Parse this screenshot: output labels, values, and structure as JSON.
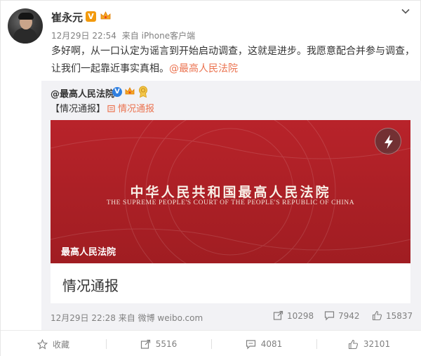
{
  "post": {
    "username": "崔永元",
    "time": "12月29日 22:54",
    "source_prefix": "来自",
    "source": "iPhone客户端",
    "text_main": "多好啊，从一口认定为谣言到开始启动调查，这就是进步。我愿意配合并参与调查，让我们一起靠近事实真相。",
    "mention": "@最高人民法院"
  },
  "repost": {
    "username": "@最高人民法院",
    "tag": "【情况通报】",
    "link_label": "情况通报",
    "card": {
      "banner_title_cn": "中华人民共和国最高人民法院",
      "banner_title_en": "THE SUPREME PEOPLE'S COURT OF THE PEOPLE'S REPUBLIC OF CHINA",
      "banner_source": "最高人民法院",
      "title": "情况通报"
    },
    "time": "12月29日 22:28",
    "source_prefix": "来自",
    "source": "微博 weibo.com",
    "reposts": "10298",
    "comments": "7942",
    "likes": "15837"
  },
  "actions": {
    "favorite": "收藏",
    "repost": "5516",
    "comment": "4081",
    "like": "32101"
  },
  "icons": [
    "chevron-down-icon",
    "verified-v-icon",
    "crown-icon",
    "medal-icon",
    "flash-icon",
    "link-icon",
    "repost-icon",
    "comment-icon",
    "like-icon",
    "star-icon"
  ],
  "colors": {
    "accent": "#eb7350",
    "banner": "#b8232a",
    "verified_orange": "#f29a0d",
    "verified_blue": "#2f7fe0"
  }
}
